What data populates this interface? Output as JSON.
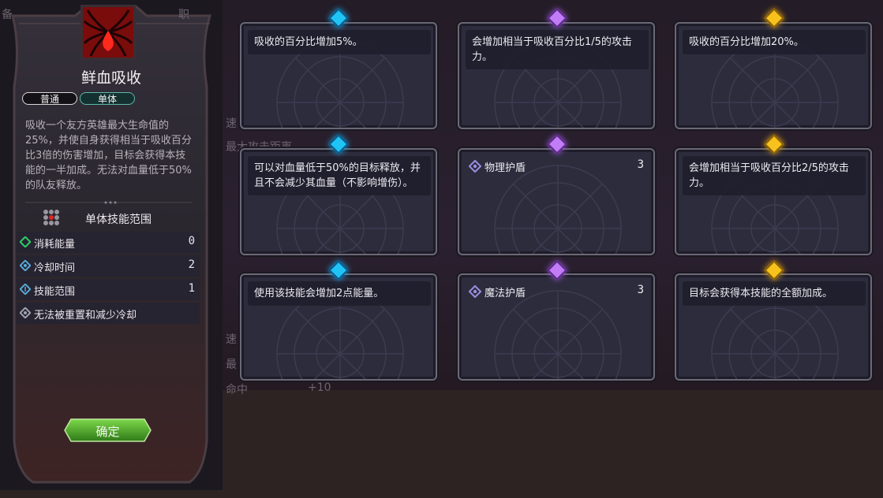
{
  "background": {
    "fragments": [
      "备",
      "职",
      "速",
      "最大攻击距离",
      "速",
      "最",
      "命中",
      "+10"
    ]
  },
  "skill_panel": {
    "skill_name": "鲜血吸收",
    "tags": [
      "普通",
      "单体"
    ],
    "description": "吸收一个友方英雄最大生命值的25%，并使自身获得相当于吸收百分比3倍的伤害增加，目标会获得本技能的一半加成。无法对血量低于50%的队友释放。",
    "range_label": "单体技能范围",
    "stats": [
      {
        "label": "消耗能量",
        "value": "0",
        "icon": "energy-icon",
        "color": "#2fd06a"
      },
      {
        "label": "冷却时间",
        "value": "2",
        "icon": "cooldown-icon",
        "color": "#5aa8d8"
      },
      {
        "label": "技能范围",
        "value": "1",
        "icon": "range-icon",
        "color": "#5aa8d8"
      },
      {
        "label": "无法被重置和减少冷却",
        "value": "",
        "icon": "no-reset-icon",
        "color": "#a0a4b0"
      }
    ],
    "confirm_label": "确定"
  },
  "cards": [
    {
      "gem": "blue",
      "text": "吸收的百分比增加5%。"
    },
    {
      "gem": "purple",
      "text": "会增加相当于吸收百分比1/5的攻击力。"
    },
    {
      "gem": "gold",
      "text": "吸收的百分比增加20%。"
    },
    {
      "gem": "blue",
      "text": "可以对血量低于50%的目标释放，并且不会减少其血量（不影响增伤）。"
    },
    {
      "gem": "purple",
      "stat_label": "物理护盾",
      "stat_value": "3",
      "icon": "physical-shield-icon"
    },
    {
      "gem": "gold",
      "text": "会增加相当于吸收百分比2/5的攻击力。"
    },
    {
      "gem": "blue",
      "text": "使用该技能会增加2点能量。"
    },
    {
      "gem": "purple",
      "stat_label": "魔法护盾",
      "stat_value": "3",
      "icon": "magic-shield-icon"
    },
    {
      "gem": "gold",
      "text": "目标会获得本技能的全额加成。"
    }
  ],
  "colors": {
    "gem_blue": "#1fc4f4",
    "gem_purple": "#c27cf6",
    "gem_gold": "#f8c21c",
    "confirm_green": "#4caa2c",
    "skill_red": "#c01818"
  }
}
